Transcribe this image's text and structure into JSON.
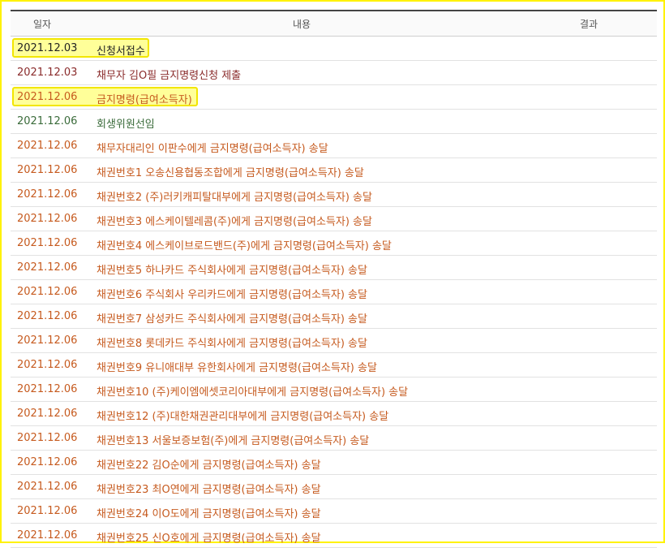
{
  "header": {
    "date_col": "일자",
    "content_col": "내용",
    "result_col": "결과"
  },
  "rows": [
    {
      "date": "2021.12.03",
      "content": "신청서접수"
    },
    {
      "date": "2021.12.03",
      "content": "채무자 김O필 금지명령신청 제출"
    },
    {
      "date": "2021.12.06",
      "content": "금지명령(급여소득자)"
    },
    {
      "date": "2021.12.06",
      "content": "회생위원선임"
    },
    {
      "date": "2021.12.06",
      "content": "채무자대리인 이판수에게 금지명령(급여소득자) 송달"
    },
    {
      "date": "2021.12.06",
      "content": "채권번호1 오송신용협동조합에게 금지명령(급여소득자) 송달"
    },
    {
      "date": "2021.12.06",
      "content": "채권번호2 (주)러키캐피탈대부에게 금지명령(급여소득자) 송달"
    },
    {
      "date": "2021.12.06",
      "content": "채권번호3 에스케이텔레콤(주)에게 금지명령(급여소득자) 송달"
    },
    {
      "date": "2021.12.06",
      "content": "채권번호4 에스케이브로드밴드(주)에게 금지명령(급여소득자) 송달"
    },
    {
      "date": "2021.12.06",
      "content": "채권번호5 하나카드 주식회사에게 금지명령(급여소득자) 송달"
    },
    {
      "date": "2021.12.06",
      "content": "채권번호6 주식회사 우리카드에게 금지명령(급여소득자) 송달"
    },
    {
      "date": "2021.12.06",
      "content": "채권번호7 삼성카드 주식회사에게 금지명령(급여소득자) 송달"
    },
    {
      "date": "2021.12.06",
      "content": "채권번호8 롯데카드 주식회사에게 금지명령(급여소득자) 송달"
    },
    {
      "date": "2021.12.06",
      "content": "채권번호9 유니애대부 유한회사에게 금지명령(급여소득자) 송달"
    },
    {
      "date": "2021.12.06",
      "content": "채권번호10 (주)케이엠에셋코리아대부에게 금지명령(급여소득자) 송달"
    },
    {
      "date": "2021.12.06",
      "content": "채권번호12 (주)대한채권관리대부에게 금지명령(급여소득자) 송달"
    },
    {
      "date": "2021.12.06",
      "content": "채권번호13 서울보증보험(주)에게 금지명령(급여소득자) 송달"
    },
    {
      "date": "2021.12.06",
      "content": "채권번호22 김O순에게 금지명령(급여소득자) 송달"
    },
    {
      "date": "2021.12.06",
      "content": "채권번호23 최O연에게 금지명령(급여소득자) 송달"
    },
    {
      "date": "2021.12.06",
      "content": "채권번호24 이O도에게 금지명령(급여소득자) 송달"
    },
    {
      "date": "2021.12.06",
      "content": "채권번호25 신O호에게 금지명령(급여소득자) 송달"
    }
  ]
}
